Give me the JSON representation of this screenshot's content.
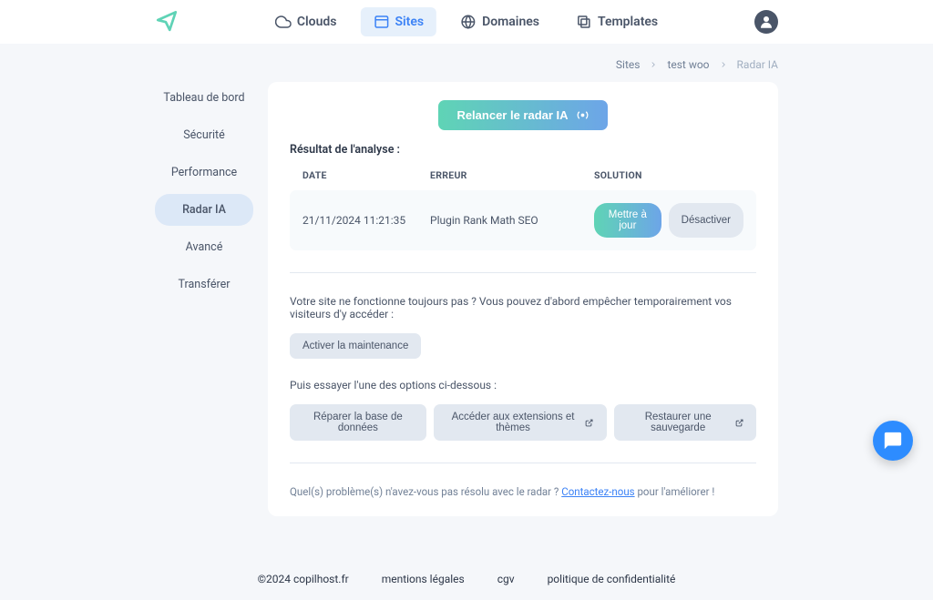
{
  "nav": {
    "clouds": "Clouds",
    "sites": "Sites",
    "domaines": "Domaines",
    "templates": "Templates"
  },
  "breadcrumb": {
    "sites": "Sites",
    "testwoo": "test woo",
    "radar": "Radar IA"
  },
  "sidebar": {
    "tableau": "Tableau de bord",
    "securite": "Sécurité",
    "performance": "Performance",
    "radar": "Radar IA",
    "avance": "Avancé",
    "transferer": "Transférer"
  },
  "cta": "Relancer le radar IA",
  "section_title": "Résultat de l'analyse :",
  "table": {
    "head_date": "DATE",
    "head_error": "ERREUR",
    "head_solution": "SOLUTION",
    "row": {
      "date": "21/11/2024 11:21:35",
      "error": "Plugin Rank Math SEO",
      "update": "Mettre à jour",
      "deactivate": "Désactiver"
    }
  },
  "maintenance_text": "Votre site ne fonctionne toujours pas ? Vous pouvez d'abord empêcher temporairement vos visiteurs d'y accéder :",
  "maintenance_btn": "Activer la maintenance",
  "options_text": "Puis essayer l'une des options ci-dessous :",
  "options": {
    "repair": "Réparer la base de données",
    "access": "Accéder aux extensions et thèmes",
    "restore": "Restaurer une sauvegarde"
  },
  "feedback": {
    "before": "Quel(s) problème(s) n'avez-vous pas résolu avec le radar ? ",
    "link": "Contactez-nous",
    "after": " pour l'améliorer !"
  },
  "footer": {
    "copy": "©2024 copilhost.fr",
    "mentions": "mentions légales",
    "cgv": "cgv",
    "policy": "politique de confidentialité"
  }
}
